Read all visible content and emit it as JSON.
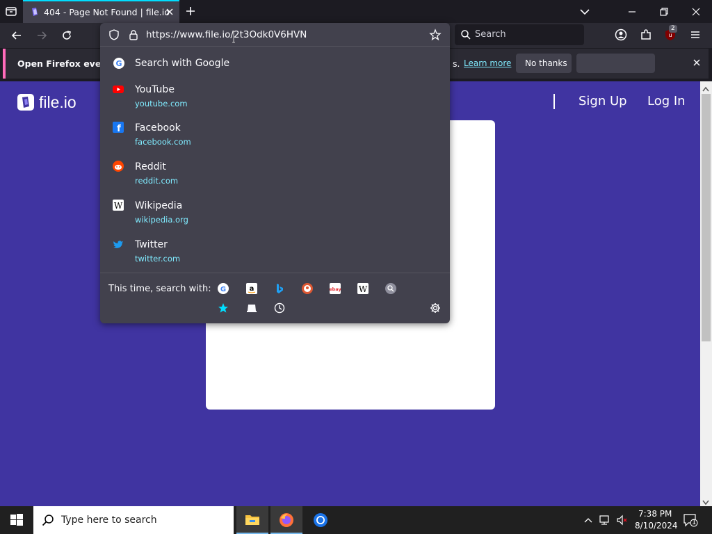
{
  "browser": {
    "tab": {
      "title": "404 - Page Not Found | file.io"
    },
    "url": "https://www.file.io/2t3Odk0V6HVN",
    "search_placeholder": "Search",
    "notification": {
      "text": "Open Firefox every ti",
      "visible_tail": "s.",
      "learn_more": "Learn more",
      "no_thanks": "No thanks"
    },
    "extension_badge": "2"
  },
  "url_dropdown": {
    "search_with": "Search with Google",
    "suggestions": [
      {
        "title": "YouTube",
        "url": "youtube.com",
        "icon": "youtube-icon"
      },
      {
        "title": "Facebook",
        "url": "facebook.com",
        "icon": "facebook-icon"
      },
      {
        "title": "Reddit",
        "url": "reddit.com",
        "icon": "reddit-icon"
      },
      {
        "title": "Wikipedia",
        "url": "wikipedia.org",
        "icon": "wikipedia-icon"
      },
      {
        "title": "Twitter",
        "url": "twitter.com",
        "icon": "twitter-icon"
      }
    ],
    "this_time_label": "This time, search with:",
    "engines": [
      "google",
      "amazon",
      "bing",
      "duckduckgo",
      "ebay",
      "wikipedia",
      "search-engine"
    ],
    "modes": [
      "bookmarks",
      "tabs",
      "history"
    ]
  },
  "page": {
    "logo_text": "file.io",
    "sign_up": "Sign Up",
    "log_in": "Log In"
  },
  "taskbar": {
    "search_placeholder": "Type here to search",
    "time": "7:38 PM",
    "date": "8/10/2024",
    "notification_count": "1"
  },
  "colors": {
    "page_bg": "#4034a1",
    "accent": "#00ddff",
    "link": "#80ebff"
  }
}
